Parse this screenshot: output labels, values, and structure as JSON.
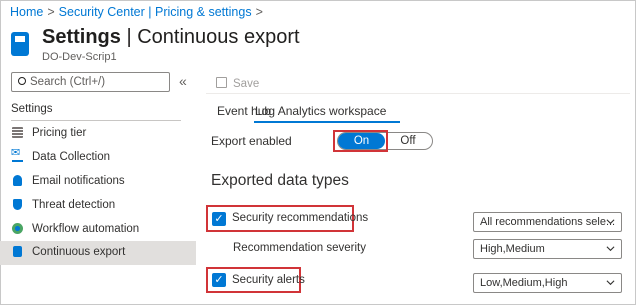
{
  "breadcrumb": {
    "home": "Home",
    "sep1": ">",
    "section": "Security Center | Pricing & settings",
    "sep2": ">"
  },
  "header": {
    "title_bold": "Settings",
    "title_rest": " | Continuous export",
    "subtitle": "DO-Dev-Scrip1"
  },
  "search": {
    "placeholder": "Search (Ctrl+/)",
    "collapse": "«"
  },
  "sidebar": {
    "header": "Settings",
    "items": [
      {
        "label": "Pricing tier",
        "icon": "pricing-tier-icon"
      },
      {
        "label": "Data Collection",
        "icon": "data-collection-icon"
      },
      {
        "label": "Email notifications",
        "icon": "email-notifications-icon"
      },
      {
        "label": "Threat detection",
        "icon": "threat-detection-icon"
      },
      {
        "label": "Workflow automation",
        "icon": "workflow-automation-icon"
      },
      {
        "label": "Continuous export",
        "icon": "continuous-export-icon",
        "active": true
      }
    ]
  },
  "toolbar": {
    "save_label": "Save"
  },
  "tabs": [
    {
      "label": "Event hub",
      "active": false
    },
    {
      "label": "Log Analytics workspace",
      "active": true
    }
  ],
  "export": {
    "label": "Export enabled",
    "on_label": "On",
    "off_label": "Off",
    "selected": "On"
  },
  "data_types": {
    "title": "Exported data types",
    "security_recommendations": {
      "label": "Security recommendations",
      "checked": true,
      "dropdown_value": "All recommendations sele..."
    },
    "recommendation_severity": {
      "label": "Recommendation severity",
      "dropdown_value": "High,Medium"
    },
    "security_alerts": {
      "label": "Security alerts",
      "checked": true,
      "dropdown_value": "Low,Medium,High"
    }
  },
  "colors": {
    "accent": "#0078d4",
    "highlight_border": "#d13438",
    "active_item_bg": "#e1dfdd"
  }
}
